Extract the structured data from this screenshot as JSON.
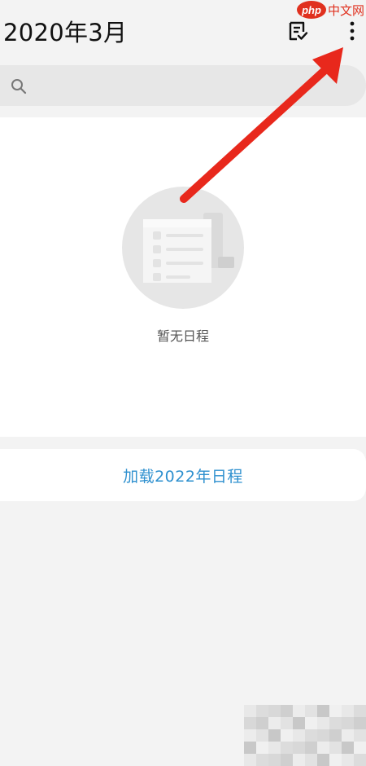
{
  "header": {
    "title": "2020年3月"
  },
  "watermark": {
    "logo": "php",
    "text": "中文网"
  },
  "search": {
    "placeholder": ""
  },
  "empty_state": {
    "message": "暂无日程"
  },
  "load_button": {
    "label": "加载2022年日程"
  },
  "colors": {
    "background": "#f3f3f3",
    "card": "#ffffff",
    "search_bg": "#e7e7e7",
    "accent_link": "#2e90cf",
    "annotation_arrow": "#e8281c",
    "watermark_red": "#e0301e"
  },
  "icons": {
    "list_check": "list-check-icon",
    "more": "more-vertical-icon",
    "search": "search-icon",
    "empty": "empty-schedule-illustration"
  }
}
